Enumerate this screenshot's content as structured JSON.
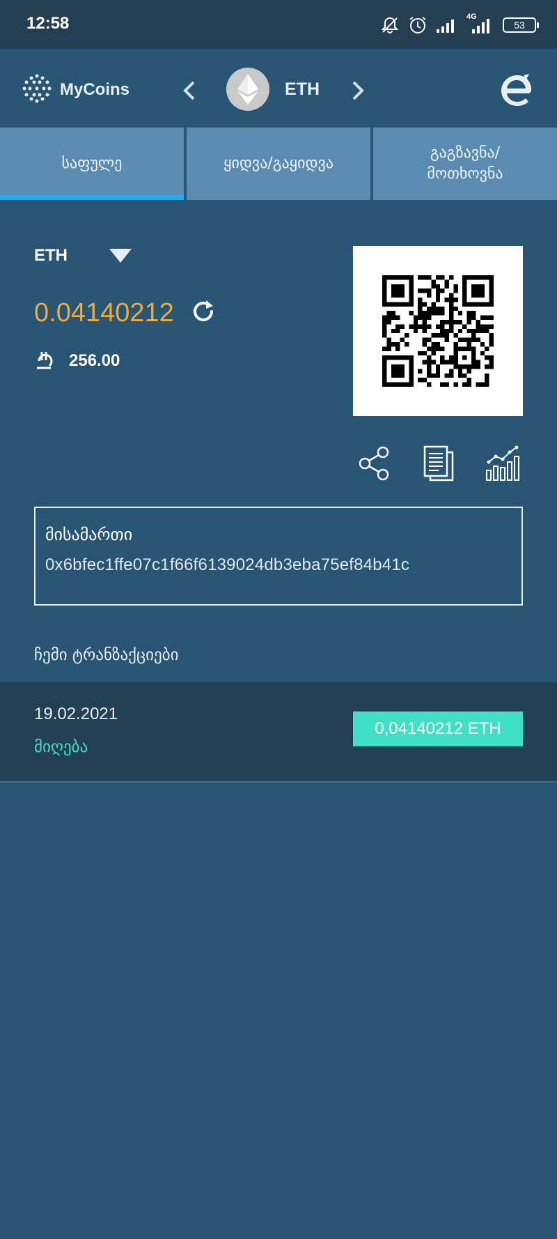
{
  "status_bar": {
    "time": "12:58",
    "network": "4G",
    "battery": "53"
  },
  "header": {
    "logo_text": "MyCoins",
    "coin": "ETH",
    "icons": [
      "chevron-left-icon",
      "ethereum-icon",
      "chevron-right-icon",
      "brand-e-logo"
    ]
  },
  "tabs": [
    {
      "label": "საფულე",
      "active": true
    },
    {
      "label": "ყიდვა/გაყიდვა",
      "active": false
    },
    {
      "label": "გაგზავნა/\nმოთხოვნა",
      "active": false
    }
  ],
  "wallet": {
    "currency": "ETH",
    "balance": "0.04140212",
    "fiat_value": "256.00",
    "address_label": "მისამართი",
    "address": "0x6bfec1ffe07c1f66f6139024db3eba75ef84b41c"
  },
  "transactions": {
    "title": "ჩემი ტრანზაქციები",
    "items": [
      {
        "date": "19.02.2021",
        "status": "მიღება",
        "amount": "0,04140212 ETH"
      }
    ]
  },
  "colors": {
    "background": "#285573",
    "status_bar": "#243f52",
    "tab": "#5b8bb0",
    "tab_indicator": "#29a8ec",
    "balance": "#f2a93b",
    "received": "#3fe0c5",
    "tx_row": "#233f53"
  }
}
